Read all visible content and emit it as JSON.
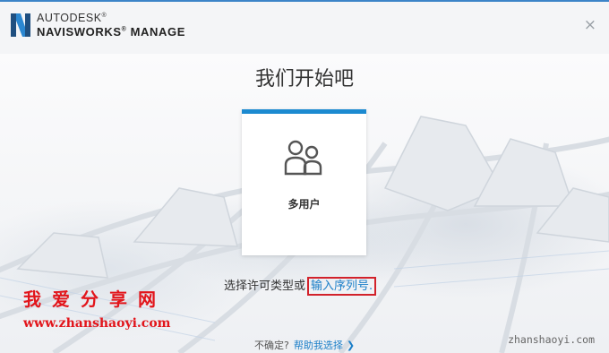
{
  "header": {
    "brand": "AUTODESK",
    "brand_reg": "®",
    "product": "NAVISWORKS",
    "product_reg": "®",
    "product_suffix": " MANAGE",
    "close_glyph": "×"
  },
  "main": {
    "title": "我们开始吧",
    "card": {
      "label": "多用户",
      "icon": "users-icon"
    },
    "choose_text": "选择许可类型或",
    "serial_link": "输入序列号."
  },
  "footer": {
    "unsure": "不确定?",
    "help_link": "帮助我选择",
    "help_chevron": "❯"
  },
  "watermark": {
    "title": "我爱分享网",
    "url_left": "www.zhanshaoyi.com",
    "url_right": "zhanshaoyi.com"
  },
  "colors": {
    "accent": "#1c8ad0",
    "link": "#1a7ec8",
    "watermark_red": "#e2151b"
  }
}
